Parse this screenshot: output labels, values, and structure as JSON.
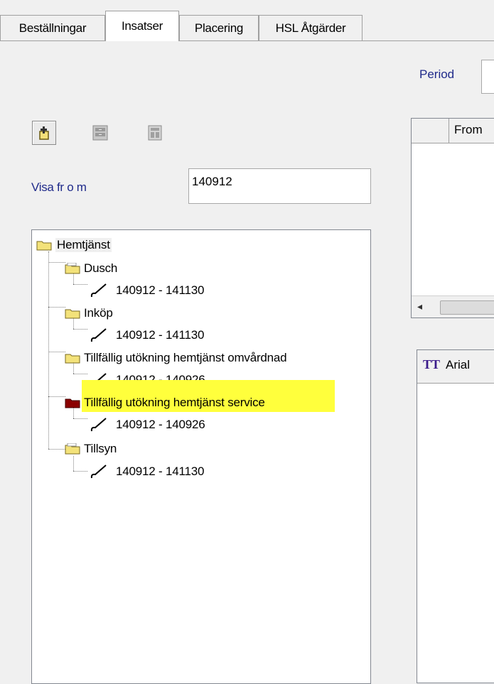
{
  "tabs": [
    {
      "label": "Beställningar"
    },
    {
      "label": "Insatser"
    },
    {
      "label": "Placering"
    },
    {
      "label": "HSL Åtgärder"
    }
  ],
  "period": {
    "label": "Period"
  },
  "toolbar": {
    "icons": [
      "add-insats-icon",
      "cabinet-icon",
      "document-icon"
    ]
  },
  "visa": {
    "label": "Visa fr o m",
    "value": "140912"
  },
  "tree": {
    "root": "Hemtjänst",
    "children": [
      {
        "label": "Dusch",
        "period": "140912 - 141130"
      },
      {
        "label": "Inköp",
        "period": "140912 - 141130"
      },
      {
        "label": "Tillfällig utökning hemtjänst omvårdnad",
        "period": "140912 - 140926"
      },
      {
        "label": "Tillfällig utökning hemtjänst service",
        "period": "140912 - 140926"
      },
      {
        "label": "Tillsyn",
        "period": "140912 - 141130"
      }
    ]
  },
  "grid": {
    "column_from": "From",
    "scroll_left": "◂"
  },
  "editor": {
    "font_icon": "TT",
    "font_name": "Arial"
  },
  "colors": {
    "highlight": "#ffff3c",
    "folder_yellow": "#f3e27a",
    "folder_selected": "#8b0000",
    "link_blue": "#2222aa"
  }
}
